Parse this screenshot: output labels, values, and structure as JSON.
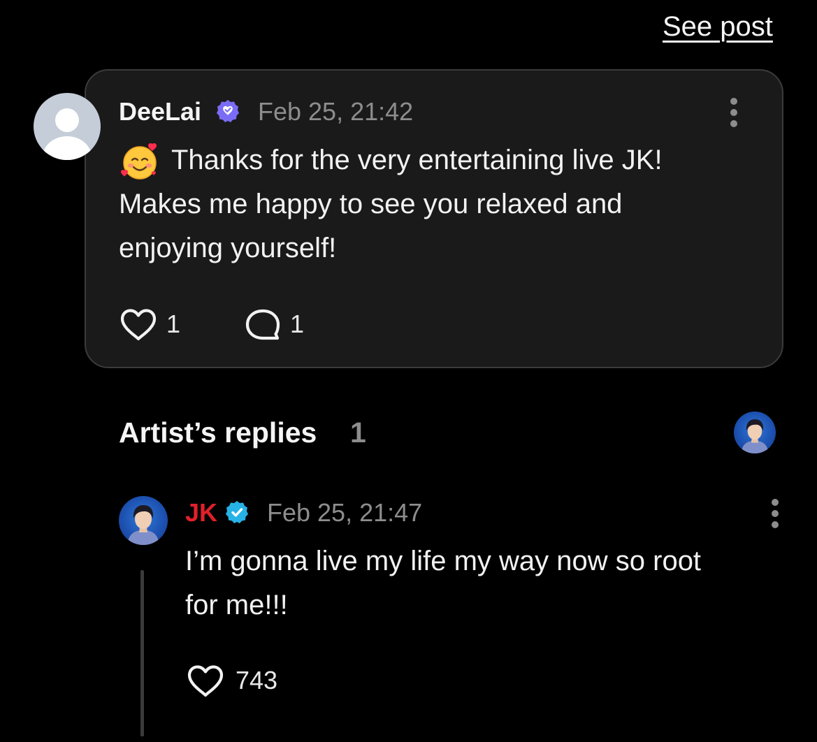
{
  "header": {
    "see_post_label": "See post"
  },
  "comment": {
    "author": "DeeLai",
    "timestamp": "Feb 25, 21:42",
    "text_line_1": "Thanks for the very entertaining live JK!",
    "text_line_2": "Makes me happy to see you relaxed and",
    "text_line_3": "enjoying yourself!",
    "emoji_icon": "smiling-face-with-hearts-icon",
    "like_count": "1",
    "reply_count": "1"
  },
  "artist_replies": {
    "title": "Artist’s replies",
    "count": "1",
    "reply": {
      "author": "JK",
      "timestamp": "Feb 25, 21:47",
      "text_line_1": "I’m gonna live my life my way now so root",
      "text_line_2": "for me!!!",
      "like_count": "743"
    }
  },
  "colors": {
    "background": "#000000",
    "card_background": "#1a1a1a",
    "card_border": "#3b3b3b",
    "muted_text": "#8d8d8d",
    "artist_name": "#e0202a",
    "fan_badge": "#7b6cf6",
    "artist_badge": "#27b2e6"
  }
}
